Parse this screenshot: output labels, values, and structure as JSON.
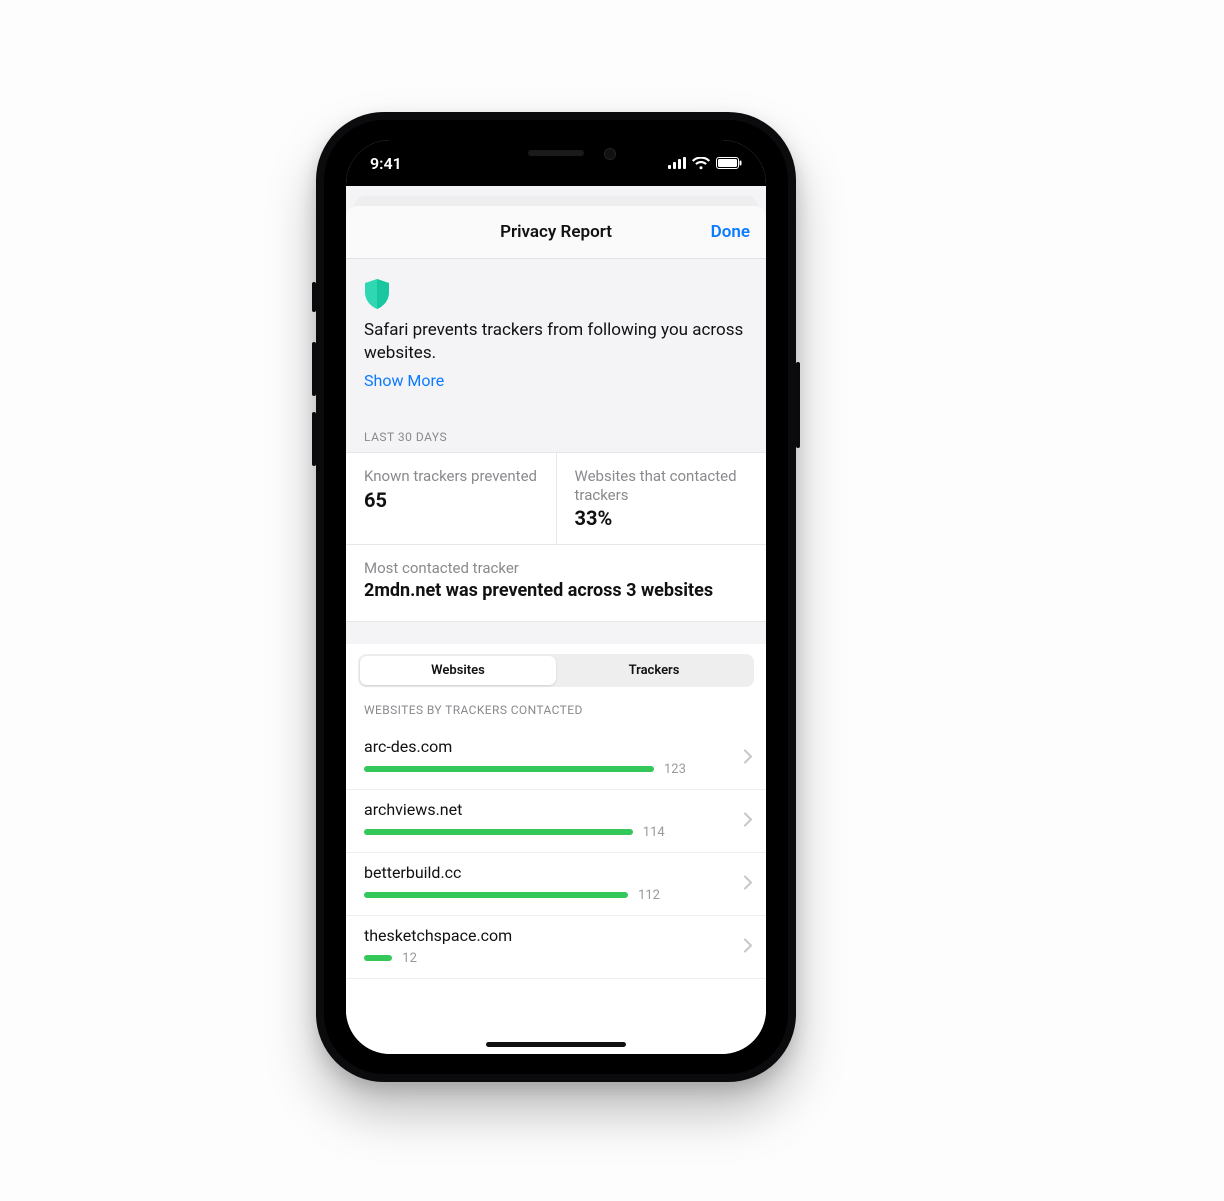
{
  "status": {
    "time": "9:41"
  },
  "sheet": {
    "title": "Privacy Report",
    "done": "Done",
    "intro": "Safari prevents trackers from following you across websites.",
    "show_more": "Show More",
    "period_label": "LAST 30 DAYS",
    "stat_prevented_label": "Known trackers prevented",
    "stat_prevented_value": "65",
    "stat_contacted_label": "Websites that contacted trackers",
    "stat_contacted_value": "33%",
    "most_label": "Most contacted tracker",
    "most_value": "2mdn.net was prevented across 3 websites",
    "seg_websites": "Websites",
    "seg_trackers": "Trackers",
    "list_label": "WEBSITES BY TRACKERS CONTACTED",
    "max_count": 123,
    "rows": [
      {
        "domain": "arc-des.com",
        "count": 123
      },
      {
        "domain": "archviews.net",
        "count": 114
      },
      {
        "domain": "betterbuild.cc",
        "count": 112
      },
      {
        "domain": "thesketchspace.com",
        "count": 12
      }
    ]
  }
}
